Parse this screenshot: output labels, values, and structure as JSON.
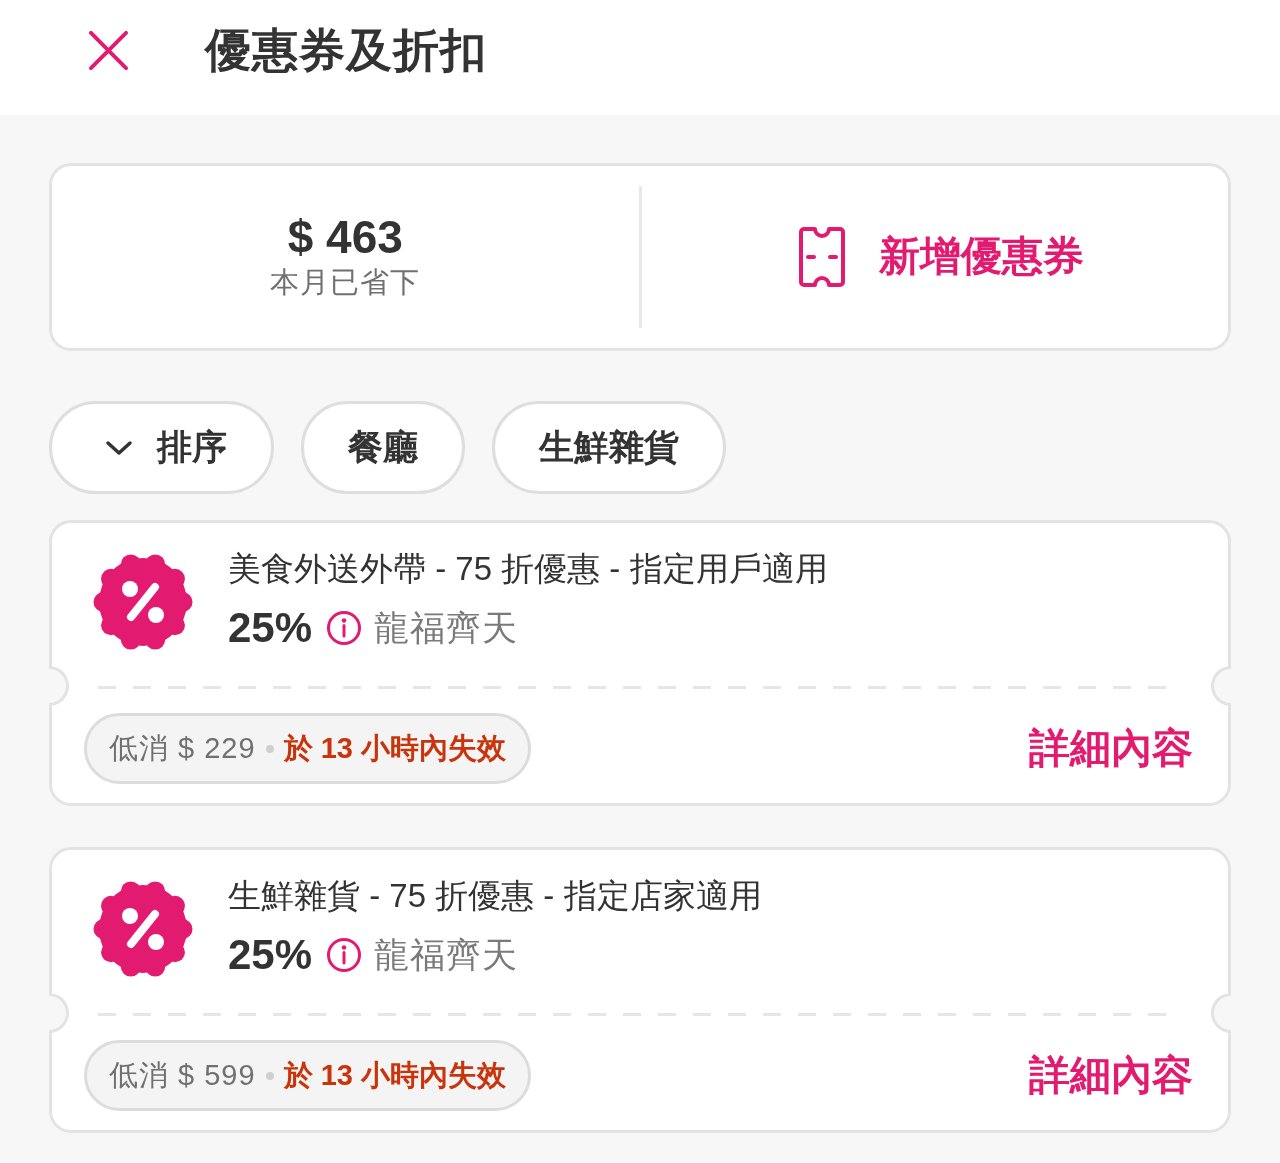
{
  "header": {
    "title": "優惠券及折扣"
  },
  "summary": {
    "amount": "$ 463",
    "caption": "本月已省下",
    "add_button": "新增優惠券"
  },
  "filters": [
    {
      "label": "排序",
      "kind": "sort"
    },
    {
      "label": "餐廳",
      "kind": "chip"
    },
    {
      "label": "生鮮雜貨",
      "kind": "chip"
    }
  ],
  "vouchers": [
    {
      "title": "美食外送外帶 - 75 折優惠 - 指定用戶適用",
      "discount": "25%",
      "brand": "龍福齊天",
      "minimum": "低消 $ 229",
      "expiry": "於 13 小時內失效",
      "details": "詳細內容"
    },
    {
      "title": "生鮮雜貨 - 75 折優惠 - 指定店家適用",
      "discount": "25%",
      "brand": "龍福齊天",
      "minimum": "低消 $ 599",
      "expiry": "於 13 小時內失效",
      "details": "詳細內容"
    }
  ]
}
